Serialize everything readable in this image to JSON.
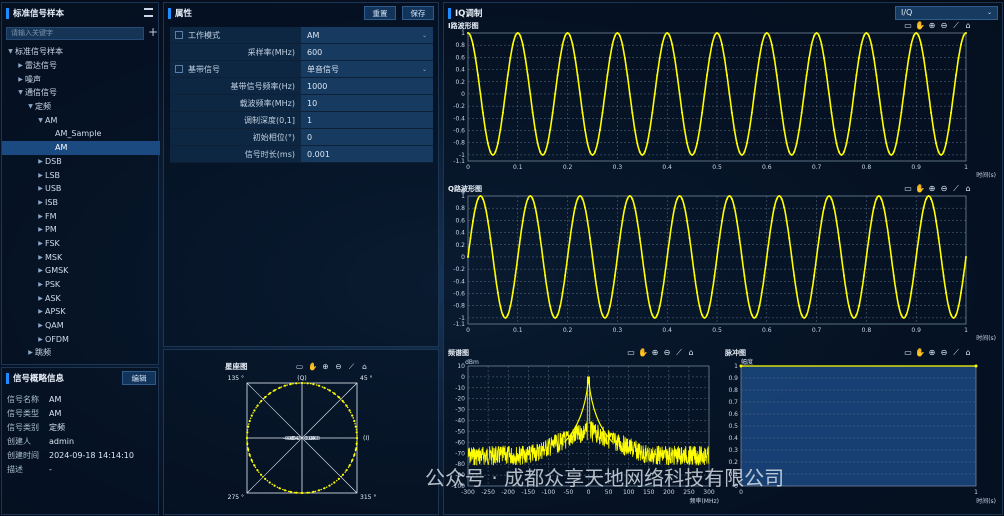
{
  "left": {
    "title": "标准信号样本",
    "search_placeholder": "请输入关键字",
    "add_icon": "plus-icon",
    "tree": [
      {
        "label": "标准信号样本",
        "level": 0,
        "arrow": "down"
      },
      {
        "label": "雷达信号",
        "level": 1,
        "arrow": "right"
      },
      {
        "label": "噪声",
        "level": 1,
        "arrow": "right"
      },
      {
        "label": "通信信号",
        "level": 1,
        "arrow": "down"
      },
      {
        "label": "定频",
        "level": 2,
        "arrow": "down"
      },
      {
        "label": "AM",
        "level": 3,
        "arrow": "down"
      },
      {
        "label": "AM_Sample",
        "level": 4,
        "arrow": ""
      },
      {
        "label": "AM",
        "level": 4,
        "arrow": "",
        "selected": true
      },
      {
        "label": "DSB",
        "level": 3,
        "arrow": "right"
      },
      {
        "label": "LSB",
        "level": 3,
        "arrow": "right"
      },
      {
        "label": "USB",
        "level": 3,
        "arrow": "right"
      },
      {
        "label": "ISB",
        "level": 3,
        "arrow": "right"
      },
      {
        "label": "FM",
        "level": 3,
        "arrow": "right"
      },
      {
        "label": "PM",
        "level": 3,
        "arrow": "right"
      },
      {
        "label": "FSK",
        "level": 3,
        "arrow": "right"
      },
      {
        "label": "MSK",
        "level": 3,
        "arrow": "right"
      },
      {
        "label": "GMSK",
        "level": 3,
        "arrow": "right"
      },
      {
        "label": "PSK",
        "level": 3,
        "arrow": "right"
      },
      {
        "label": "ASK",
        "level": 3,
        "arrow": "right"
      },
      {
        "label": "APSK",
        "level": 3,
        "arrow": "right"
      },
      {
        "label": "QAM",
        "level": 3,
        "arrow": "right"
      },
      {
        "label": "OFDM",
        "level": 3,
        "arrow": "right"
      },
      {
        "label": "跳频",
        "level": 2,
        "arrow": "right"
      }
    ]
  },
  "info": {
    "title": "信号概略信息",
    "edit": "编辑",
    "rows": [
      {
        "k": "信号名称",
        "v": "AM"
      },
      {
        "k": "信号类型",
        "v": "AM"
      },
      {
        "k": "信号类别",
        "v": "定频"
      },
      {
        "k": "创建人",
        "v": "admin"
      },
      {
        "k": "创建时间",
        "v": "2024-09-18 14:14:10"
      },
      {
        "k": "描述",
        "v": "-"
      }
    ]
  },
  "props": {
    "title": "属性",
    "reset": "重置",
    "save": "保存",
    "rows": [
      {
        "label": "工作模式",
        "value": "AM",
        "checkbox": true,
        "dropdown": true
      },
      {
        "label": "采样率(MHz)",
        "value": "600"
      },
      {
        "label": "基带信号",
        "value": "单音信号",
        "checkbox": true,
        "dropdown": true
      },
      {
        "label": "基带信号频率(Hz)",
        "value": "1000"
      },
      {
        "label": "载波频率(MHz)",
        "value": "10"
      },
      {
        "label": "调制深度(0,1]",
        "value": "1"
      },
      {
        "label": "初始相位(°)",
        "value": "0"
      },
      {
        "label": "信号时长(ms)",
        "value": "0.001"
      }
    ]
  },
  "iq": {
    "title": "IQ调制",
    "select": "I/Q"
  },
  "chart_data": [
    {
      "type": "line",
      "title": "I路波形图",
      "ylabel": "I",
      "xlabel": "时间(s)",
      "xlim": [
        0,
        1
      ],
      "ylim": [
        -1.1,
        1.1
      ],
      "xticks": [
        "0",
        "0.1",
        "0.2",
        "0.3",
        "0.4",
        "0.5",
        "0.6",
        "0.7",
        "0.8",
        "0.9",
        "1"
      ],
      "yticks": [
        "1",
        "0.8",
        "0.6",
        "0.4",
        "0.2",
        "0",
        "-0.2",
        "-0.4",
        "-0.6",
        "-0.8",
        "-1",
        "-1.1"
      ],
      "cycles": 10,
      "phase": "cos",
      "color": "#ffff00"
    },
    {
      "type": "line",
      "title": "Q路波形图",
      "ylabel": "Q",
      "xlabel": "时间(s)",
      "xlim": [
        0,
        1
      ],
      "ylim": [
        -1.1,
        1.1
      ],
      "xticks": [
        "0",
        "0.1",
        "0.2",
        "0.3",
        "0.4",
        "0.5",
        "0.6",
        "0.7",
        "0.8",
        "0.9",
        "1"
      ],
      "yticks": [
        "1",
        "0.8",
        "0.6",
        "0.4",
        "0.2",
        "0",
        "-0.2",
        "-0.4",
        "-0.6",
        "-0.8",
        "-1",
        "-1.1"
      ],
      "cycles": 10,
      "phase": "sin",
      "color": "#ffff00"
    },
    {
      "type": "line",
      "title": "频谱图",
      "ylabel": "dBm",
      "xlabel": "频率(MHz)",
      "xlim": [
        -300,
        300
      ],
      "ylim": [
        -100,
        10
      ],
      "xticks": [
        "-300",
        "-250",
        "-200",
        "-150",
        "-100",
        "-50",
        "0",
        "50",
        "100",
        "150",
        "200",
        "250",
        "300"
      ],
      "yticks": [
        "10",
        "0",
        "-10",
        "-20",
        "-30",
        "-40",
        "-50",
        "-60",
        "-70",
        "-80",
        "-90",
        "-100"
      ],
      "color": "#ffff00"
    },
    {
      "type": "line",
      "title": "脉冲图",
      "ylabel": "幅度",
      "xlabel": "时间(s)",
      "xlim": [
        0,
        1
      ],
      "ylim": [
        0,
        1
      ],
      "xticks": [
        "0",
        "1"
      ],
      "yticks": [
        "1",
        "0.9",
        "0.8",
        "0.7",
        "0.6",
        "0.5",
        "0.4",
        "0.3",
        "0.2",
        "0.1",
        "0"
      ],
      "value": 1,
      "color": "#ffff00"
    },
    {
      "type": "scatter",
      "title": "星座图",
      "xlabel": "(I)",
      "ylabel": "(Q)",
      "ticks": [
        "-0.8",
        "-0.6",
        "-0.4",
        "-0.2",
        "0",
        "0.2",
        "0.4",
        "0.6",
        "0.8"
      ],
      "angles": [
        "135 °",
        "45 °",
        "275 °",
        "315 °"
      ],
      "radius": 1,
      "color": "#ffff00"
    }
  ],
  "watermark": "公众号 · 成都众享天地网络科技有限公司"
}
